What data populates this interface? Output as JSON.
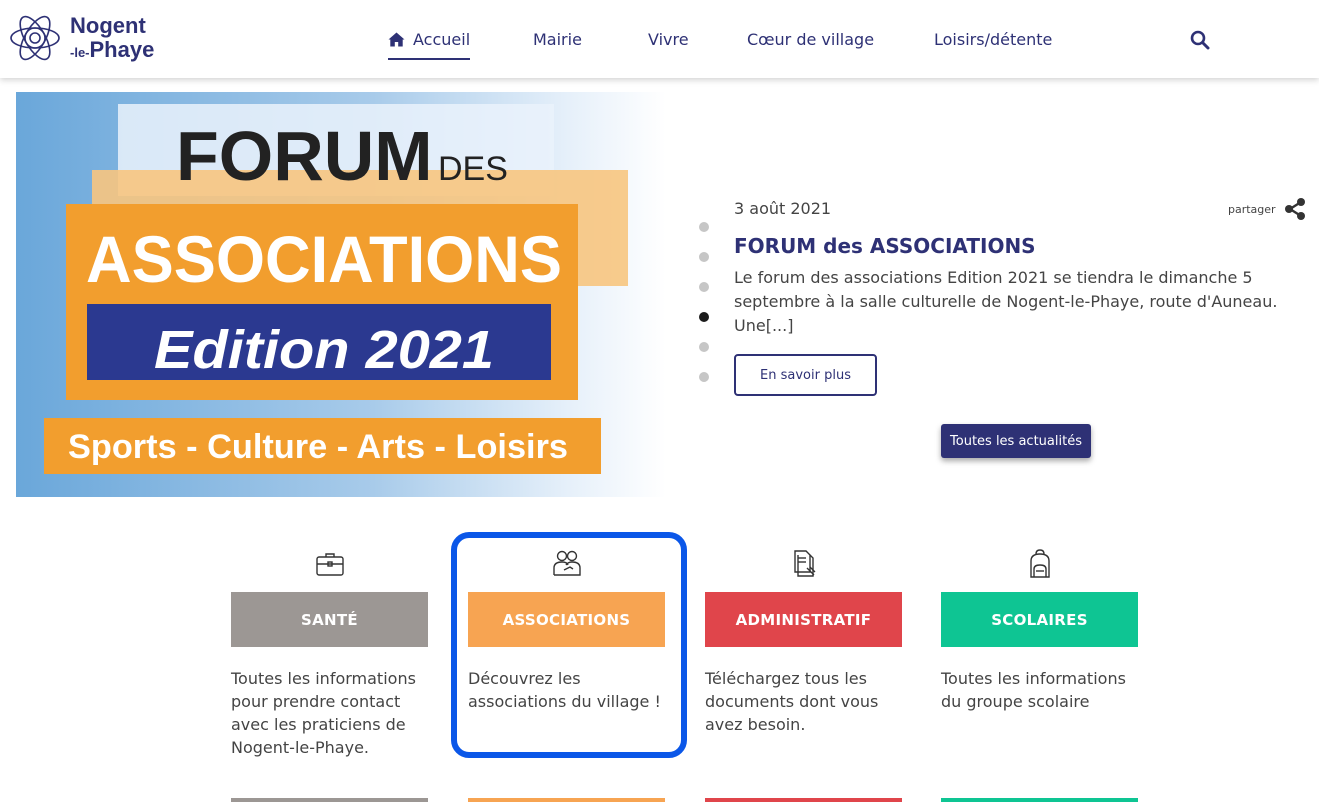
{
  "site": {
    "logo_line1": "Nogent",
    "logo_prefix": "-le-",
    "logo_line2": "Phaye"
  },
  "nav": {
    "items": [
      {
        "label": "Accueil",
        "active": true
      },
      {
        "label": "Mairie"
      },
      {
        "label": "Vivre"
      },
      {
        "label": "Cœur de village"
      },
      {
        "label": "Loisirs/détente"
      }
    ]
  },
  "hero": {
    "image": {
      "line1": "FORUM",
      "line1_small": "DES",
      "line2": "ASSOCIATIONS",
      "line3": "Edition 2021",
      "line4": "Sports - Culture - Arts - Loisirs"
    },
    "date": "3 août 2021",
    "share_label": "partager",
    "title": "FORUM des ASSOCIATIONS",
    "text": "Le forum des associations Edition 2021  se tiendra  le dimanche 5 septembre  à la salle culturelle de Nogent-le-Phaye, route d'Auneau. Une[...]",
    "more_label": "En savoir plus",
    "all_news_label": "Toutes les actualités",
    "active_dot": 4,
    "dot_count": 6
  },
  "categories": [
    {
      "label": "SANTÉ",
      "color": "#9c9794",
      "icon": "briefcase-icon",
      "desc": "Toutes les informations pour prendre contact avec les praticiens de Nogent-le-Phaye."
    },
    {
      "label": "ASSOCIATIONS",
      "color": "#f7a452",
      "icon": "people-icon",
      "desc": "Découvrez les associations du village !"
    },
    {
      "label": "ADMINISTRATIF",
      "color": "#e0454b",
      "icon": "documents-icon",
      "desc": "Téléchargez tous les documents dont vous avez besoin."
    },
    {
      "label": "SCOLAIRES",
      "color": "#0ec593",
      "icon": "backpack-icon",
      "desc": "Toutes les informations du groupe scolaire"
    }
  ],
  "colors": {
    "brand": "#2e3175",
    "focus": "#0b57e8"
  }
}
